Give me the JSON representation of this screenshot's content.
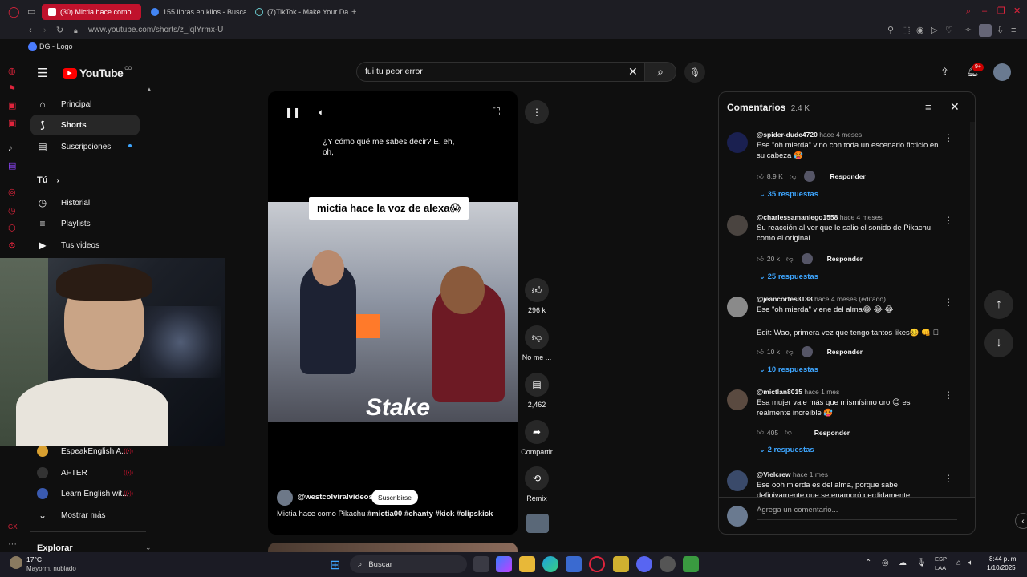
{
  "browser": {
    "tabs": [
      {
        "label": "(30) Mictia hace como",
        "active": true
      },
      {
        "label": "155 libras en kilos - Busca"
      },
      {
        "label": "(7)TikTok - Make Your Da"
      }
    ],
    "url": "www.youtube.com/shorts/z_lqlYrmx-U",
    "bookmark": "DG - Logo"
  },
  "yt": {
    "logo": "YouTube",
    "country": "CO",
    "search_value": "fui tu peor error",
    "notif_count": "9+",
    "sidebar": {
      "items": [
        {
          "label": "Principal",
          "icon": "home-icon"
        },
        {
          "label": "Shorts",
          "icon": "shorts-icon",
          "active": true
        },
        {
          "label": "Suscripciones",
          "icon": "subscriptions-icon"
        }
      ],
      "you_header": "Tú",
      "you_items": [
        {
          "label": "Historial",
          "icon": "history-icon"
        },
        {
          "label": "Playlists",
          "icon": "playlist-icon"
        },
        {
          "label": "Tus videos",
          "icon": "video-icon"
        }
      ],
      "subs": [
        {
          "label": "EspeakEnglish A..."
        },
        {
          "label": "AFTER"
        },
        {
          "label": "Learn English wit..."
        }
      ],
      "show_more": "Mostrar más",
      "explore": "Explorar"
    },
    "short": {
      "caption_text": "¿Y cómo qué me sabes decir? E, eh, oh,",
      "overlay_title": "mictia hace la voz de alexa😱",
      "brand": "Stake",
      "channel": "@westcolviralvideos",
      "subscribe": "Suscribirse",
      "title": "Mictia hace como Pikachu",
      "hashtags": "#mictia00 #chanty #kick #clipskick"
    },
    "actions": {
      "likes": "296 k",
      "dislike": "No me ...",
      "comments": "2,462",
      "share": "Compartir",
      "remix": "Remix"
    },
    "comments_panel": {
      "title": "Comentarios",
      "count": "2.4 K",
      "add_placeholder": "Agrega un comentario...",
      "reply_label": "Responder",
      "items": [
        {
          "author": "@spider-dude4720",
          "time": "hace 4 meses",
          "text": "Ese \"oh mierda\" vino con toda un escenario ficticio en su cabeza 🥵",
          "likes": "8.9 K",
          "replies": "35 respuestas"
        },
        {
          "author": "@charlessamaniego1558",
          "time": "hace 4 meses",
          "text": "Su reacción al ver que le salio el sonido de Pikachu como el original",
          "likes": "20 k",
          "replies": "25 respuestas"
        },
        {
          "author": "@jeancortes3138",
          "time": "hace 4 meses (editado)",
          "text": "Ese \"oh mierda\" viene del alma😂 😂 😂",
          "text2": "Edit: Wao, primera vez que tengo tantos likes🥴 👊 🏻",
          "likes": "10 k",
          "replies": "10 respuestas"
        },
        {
          "author": "@mictlan8015",
          "time": "hace 1 mes",
          "text": "Esa mujer vale más que mismísimo oro 😊 es realmente increíble 🥵",
          "likes": "405",
          "replies": "2 respuestas"
        },
        {
          "author": "@Vielcrew",
          "time": "hace 1 mes",
          "text": "Ese ooh mierda es del alma, porque sabe definivamente que se enamoró perdidamente"
        }
      ]
    }
  },
  "taskbar": {
    "weather_temp": "17°C",
    "weather_desc": "Mayorm. nublado",
    "search": "Buscar",
    "lang1": "ESP",
    "lang2": "LAA",
    "time": "8:44 p. m.",
    "date": "1/10/2025"
  },
  "colors": {
    "accent_red": "#c0122c",
    "yt_red": "#ff0000",
    "link_blue": "#3ea6ff"
  }
}
